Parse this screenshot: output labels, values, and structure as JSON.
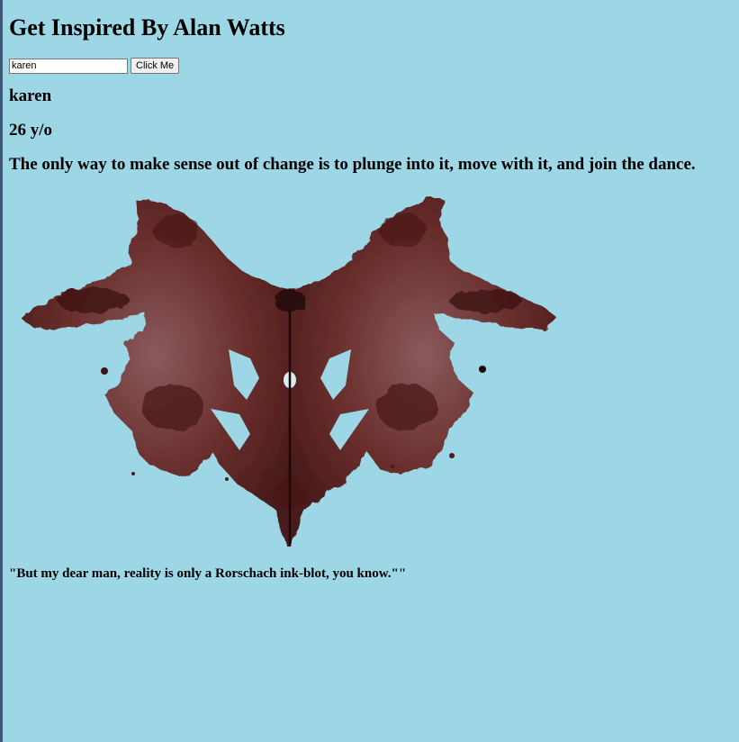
{
  "page": {
    "title": "Get Inspired By Alan Watts"
  },
  "form": {
    "input_value": "karen",
    "button_label": "Click Me"
  },
  "result": {
    "name": "karen",
    "age": "26 y/o",
    "quote": "The only way to make sense out of change is to plunge into it, move with it, and join the dance."
  },
  "footer": {
    "caption": "\"But my dear man, reality is only a Rorschach ink-blot, you know.\"\""
  },
  "colors": {
    "background": "#9dd6e5",
    "ink": "#5e2a26"
  }
}
